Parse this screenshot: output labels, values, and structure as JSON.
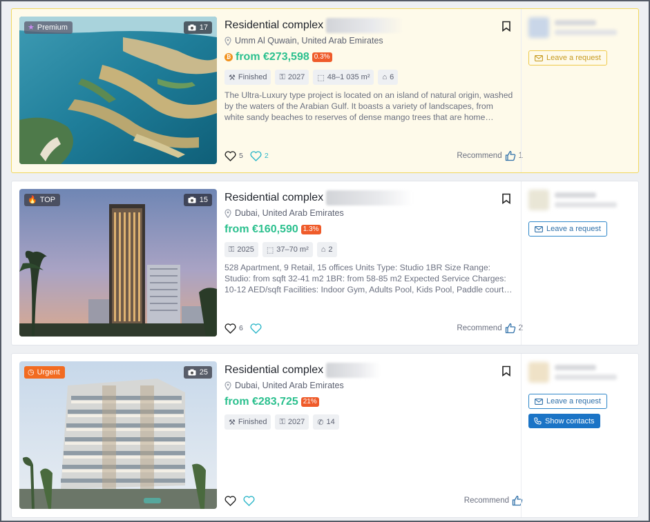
{
  "listings": [
    {
      "badge": "Premium",
      "photo_count": "17",
      "title": "Residential complex",
      "location": "Umm Al Quwain, United Arab Emirates",
      "price": "from €273,598",
      "percent": "0.3%",
      "chips": [
        "Finished",
        "2027",
        "48–1 035 m²",
        "6"
      ],
      "description": "The Ultra-Luxury type project is located on an island of natural origin, washed by the waters of the Arabian Gulf. It boasts a variety of landscapes, from white sandy beaches to reserves of dense mango trees that are home…",
      "likes": "5",
      "hearts": "2",
      "recommend_label": "Recommend",
      "recommend_count": "1",
      "request_label": "Leave a request"
    },
    {
      "badge": "TOP",
      "photo_count": "15",
      "title": "Residential complex",
      "location": "Dubai, United Arab Emirates",
      "price": "from €160,590",
      "percent": "1.3%",
      "chips": [
        "2025",
        "37–70 m²",
        "2"
      ],
      "description": "528 Apartment, 9 Retail, 15 offices Units Type: Studio 1BR Size Range: Studio: from sqft 32-41 m2 1BR: from 58-85 m2 Expected Service Charges: 10-12 AED/sqft Facilities: Indoor Gym, Adults Pool, Kids Pool, Paddle court…",
      "likes": "6",
      "hearts": "",
      "recommend_label": "Recommend",
      "recommend_count": "2",
      "request_label": "Leave a request"
    },
    {
      "badge": "Urgent",
      "photo_count": "25",
      "title": "Residential complex",
      "location": "Dubai, United Arab Emirates",
      "price": "from €283,725",
      "percent": "21%",
      "chips": [
        "Finished",
        "2027",
        "14"
      ],
      "description": "",
      "likes": "",
      "hearts": "",
      "recommend_label": "Recommend",
      "recommend_count": "",
      "request_label": "Leave a request",
      "contacts_label": "Show contacts"
    }
  ],
  "colors": {
    "price_green": "#2bc08e",
    "premium_bg": "#fefaea",
    "premium_border": "#f1d75b",
    "urgent_orange": "#f26b21",
    "contacts_blue": "#1b74c6"
  },
  "icons": {
    "bookmark": "bookmark-icon",
    "location": "location-pin-icon",
    "camera": "camera-icon",
    "like": "heart-outline-icon",
    "favorite": "heart-teal-icon",
    "recommend": "thumbs-up-icon",
    "request": "envelope-icon",
    "contacts": "phone-icon"
  }
}
